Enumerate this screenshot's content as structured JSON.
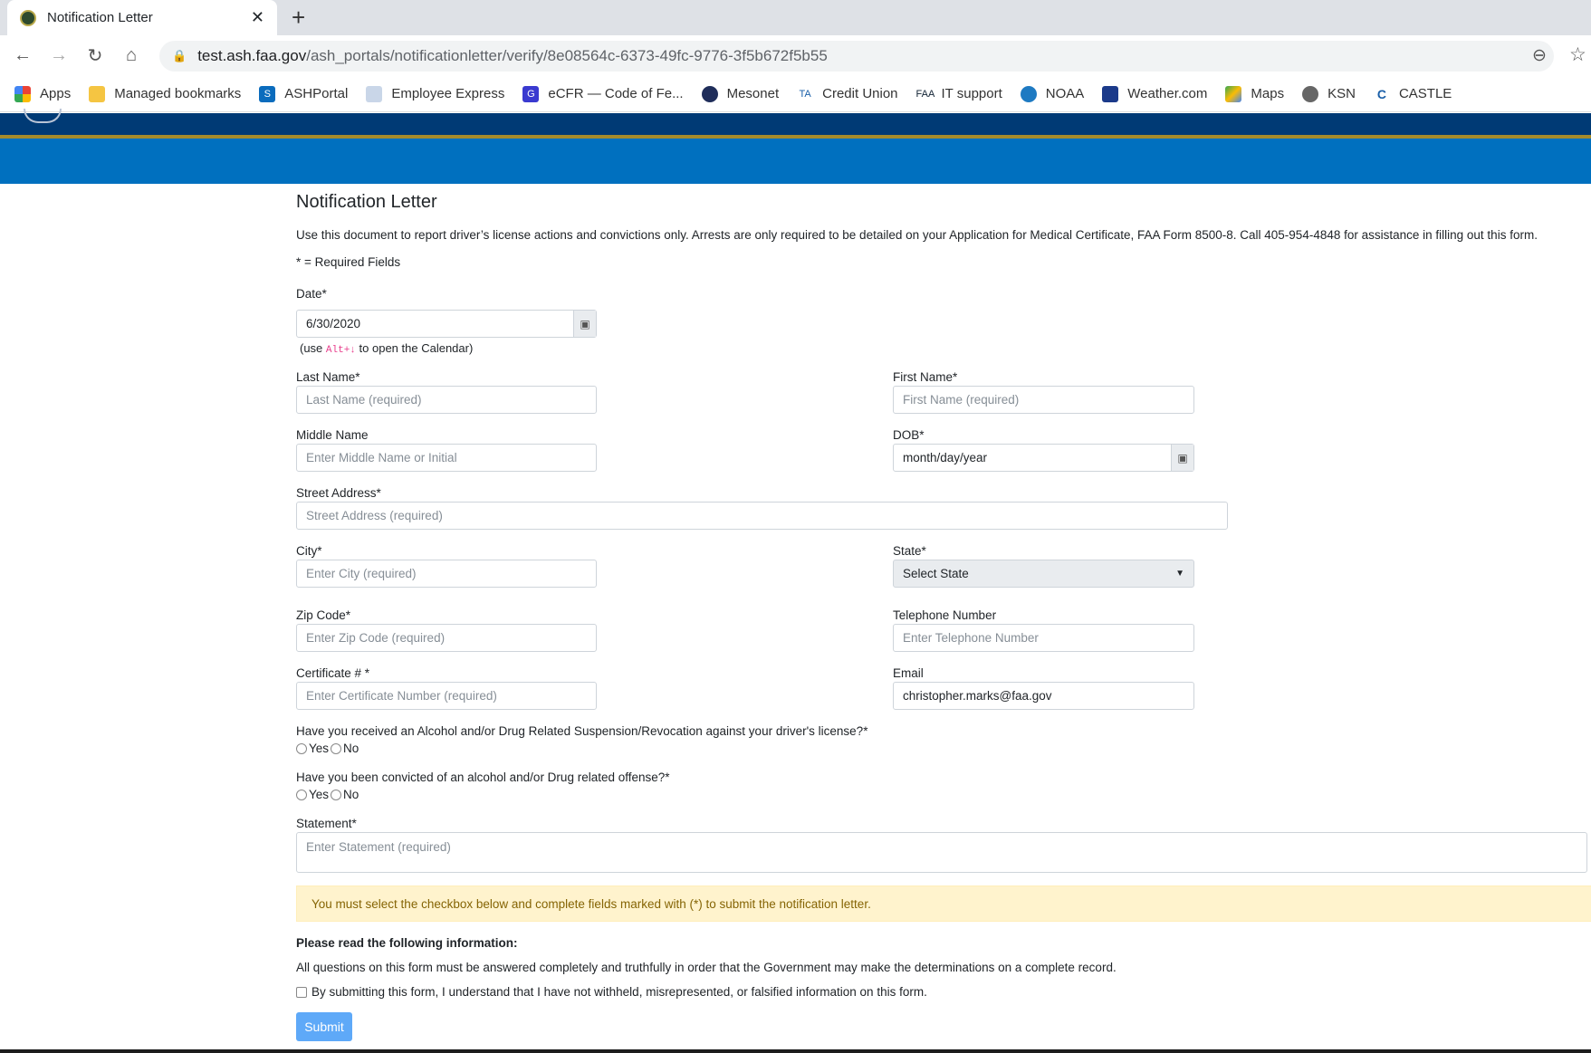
{
  "browser": {
    "tab_title": "Notification Letter",
    "url_host": "test.ash.faa.gov",
    "url_path": "/ash_portals/notificationletter/verify/8e08564c-6373-49fc-9776-3f5b672f5b55",
    "bookmarks": [
      "Apps",
      "Managed bookmarks",
      "ASHPortal",
      "Employee Express",
      "eCFR — Code of Fe...",
      "Mesonet",
      "Credit Union",
      "IT support",
      "NOAA",
      "Weather.com",
      "Maps",
      "KSN",
      "CASTLE"
    ]
  },
  "page": {
    "title": "Notification Letter",
    "intro": "Use this document to report driver’s license actions and convictions only. Arrests are only required to be detailed on your Application for Medical Certificate, FAA Form 8500-8. Call 405-954-4848 for assistance in filling out this form.",
    "required_note": "* = Required Fields",
    "date": {
      "label": "Date*",
      "value": "6/30/2020",
      "hint_pre": "(use ",
      "hint_key": "Alt+↓",
      "hint_post": " to open the Calendar)"
    },
    "last_name": {
      "label": "Last Name*",
      "placeholder": "Last Name (required)"
    },
    "first_name": {
      "label": "First Name*",
      "placeholder": "First Name (required)"
    },
    "middle_name": {
      "label": "Middle Name",
      "placeholder": "Enter Middle Name or Initial"
    },
    "dob": {
      "label": "DOB*",
      "value": "month/day/year"
    },
    "street": {
      "label": "Street Address*",
      "placeholder": "Street Address (required)"
    },
    "city": {
      "label": "City*",
      "placeholder": "Enter City (required)"
    },
    "state": {
      "label": "State*",
      "value": "Select State"
    },
    "zip": {
      "label": "Zip Code*",
      "placeholder": "Enter Zip Code (required)"
    },
    "phone": {
      "label": "Telephone Number",
      "placeholder": "Enter Telephone Number"
    },
    "cert": {
      "label": "Certificate # *",
      "placeholder": "Enter Certificate Number (required)"
    },
    "email": {
      "label": "Email",
      "value": "christopher.marks@faa.gov"
    },
    "q1": {
      "label": "Have you received an Alcohol and/or Drug Related Suspension/Revocation against your driver's license?*",
      "yes": "Yes",
      "no": "No"
    },
    "q2": {
      "label": "Have you been convicted of an alcohol and/or Drug related offense?*",
      "yes": "Yes",
      "no": "No"
    },
    "statement": {
      "label": "Statement*",
      "placeholder": "Enter Statement (required)"
    },
    "alert": "You must select the checkbox below and complete fields marked with (*) to submit the notification letter.",
    "read_heading": "Please read the following information:",
    "read_text": "All questions on this form must be answered completely and truthfully in order that the Government may make the determinations on a complete record.",
    "agree": "By submitting this form, I understand that I have not withheld, misrepresented, or falsified information on this form.",
    "submit": "Submit"
  }
}
